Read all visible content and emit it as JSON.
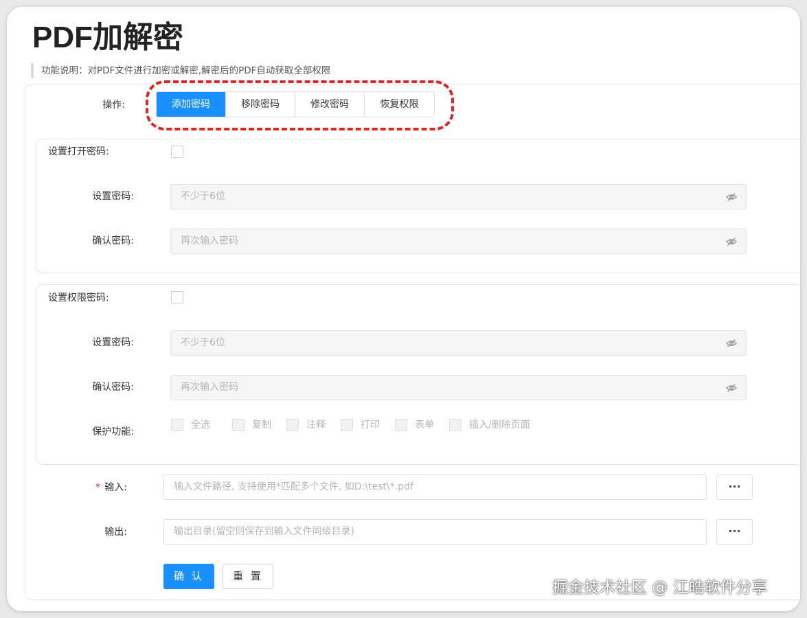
{
  "page": {
    "title": "PDF加解密",
    "description": "功能说明：对PDF文件进行加密或解密,解密后的PDF自动获取全部权限"
  },
  "operation": {
    "label": "操作:",
    "options": [
      "添加密码",
      "移除密码",
      "修改密码",
      "恢复权限"
    ],
    "selected": "添加密码"
  },
  "open_password": {
    "toggle_label": "设置打开密码:",
    "set_label": "设置密码:",
    "set_placeholder": "不少于6位",
    "confirm_label": "确认密码:",
    "confirm_placeholder": "再次输入密码"
  },
  "permission_password": {
    "toggle_label": "设置权限密码:",
    "set_label": "设置密码:",
    "set_placeholder": "不少于6位",
    "confirm_label": "确认密码:",
    "confirm_placeholder": "再次输入密码",
    "protect_label": "保护功能:",
    "protect_options": [
      "全选",
      "复制",
      "注释",
      "打印",
      "表单",
      "插入/删除页面"
    ]
  },
  "io": {
    "input_label": "输入:",
    "input_required": "*",
    "input_placeholder": "输入文件路径, 支持使用*匹配多个文件, 如D:\\test\\*.pdf",
    "output_label": "输出:",
    "output_placeholder": "输出目录(留空则保存到输入文件同级目录)",
    "browse_label": "···"
  },
  "actions": {
    "confirm_label": "确 认",
    "reset_label": "重 置"
  },
  "watermark": "掘金技术社区 @ 江皓软件分享",
  "colors": {
    "primary": "#1890ff",
    "highlight": "#e02424"
  }
}
